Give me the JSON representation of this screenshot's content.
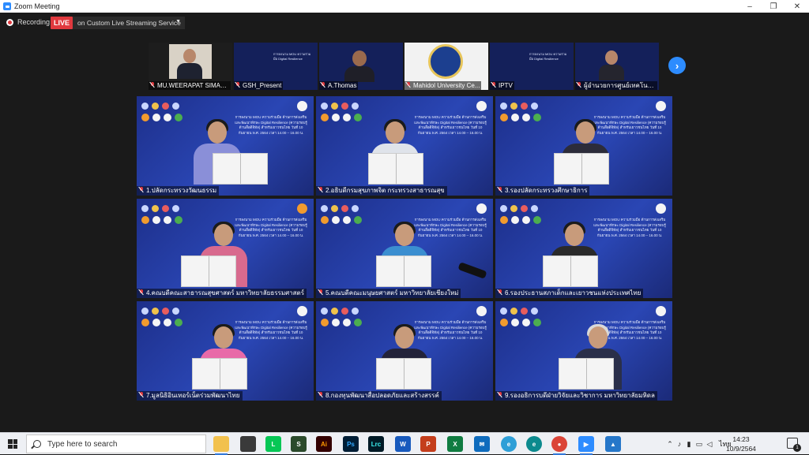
{
  "window": {
    "title": "Zoom Meeting",
    "min": "–",
    "restore": "❐",
    "close": "✕"
  },
  "recording": {
    "label": "Recording"
  },
  "live": {
    "badge": "LIVE",
    "service": "on Custom Live Streaming Service"
  },
  "strip": [
    {
      "name": "MU.WEERAPAT SIMAN..."
    },
    {
      "name": "GSH_Present"
    },
    {
      "name": "A.Thomas"
    },
    {
      "name": "Mahidol University Ce..."
    },
    {
      "name": "IPTV"
    },
    {
      "name": "ผู้อำนวยการศูนย์เทคโนโลยี..."
    }
  ],
  "banner_text": "การลงนาม MOU ความร่วมมือ ด้านการส่งเสริมและพัฒนาทักษะ Digital Resilience (ความรอบรู้ด้านสื่อดิจิทัล) สำหรับเยาวชนไทย วันที่ 10 กันยายน พ.ศ. 2564 เวลา 14.00 – 16.00 น.",
  "grid": [
    {
      "name": "1.ปลัดกระทรวงวัฒนธรรม"
    },
    {
      "name": "2.อธิบดีกรมสุขภาพจิต กระทรวงสาธารณสุข"
    },
    {
      "name": "3.รองปลัดกระทรวงศึกษาธิการ"
    },
    {
      "name": "4.คณบดีคณะสาธารณสุขศาสตร์ มหาวิทยาลัยธรรมศาสตร์"
    },
    {
      "name": "5.คณบดีคณะมนุษยศาสตร์ มหาวิทยาลัยเชียงใหม่"
    },
    {
      "name": "6.รองประธานสภาเด็กและเยาวชนแห่งประเทศไทย"
    },
    {
      "name": "7.มูลนิธิอินเทอร์เน็ตร่วมพัฒนาไทย"
    },
    {
      "name": "8.กองทุนพัฒนาสื่อปลอดภัยและสร้างสรรค์"
    },
    {
      "name": "9.รองอธิการบดีฝ่ายวิจัยและวิชาการ มหาวิทยาลัยมหิดล"
    }
  ],
  "taskbar": {
    "search_placeholder": "Type here to search",
    "language": "ไทย",
    "time": "14:23",
    "date": "10/9/2564",
    "notification_count": "1"
  },
  "colors": {
    "zoom_blue": "#2d8cff",
    "live_red": "#e0393e",
    "tile_blue": "#2a46b4"
  }
}
